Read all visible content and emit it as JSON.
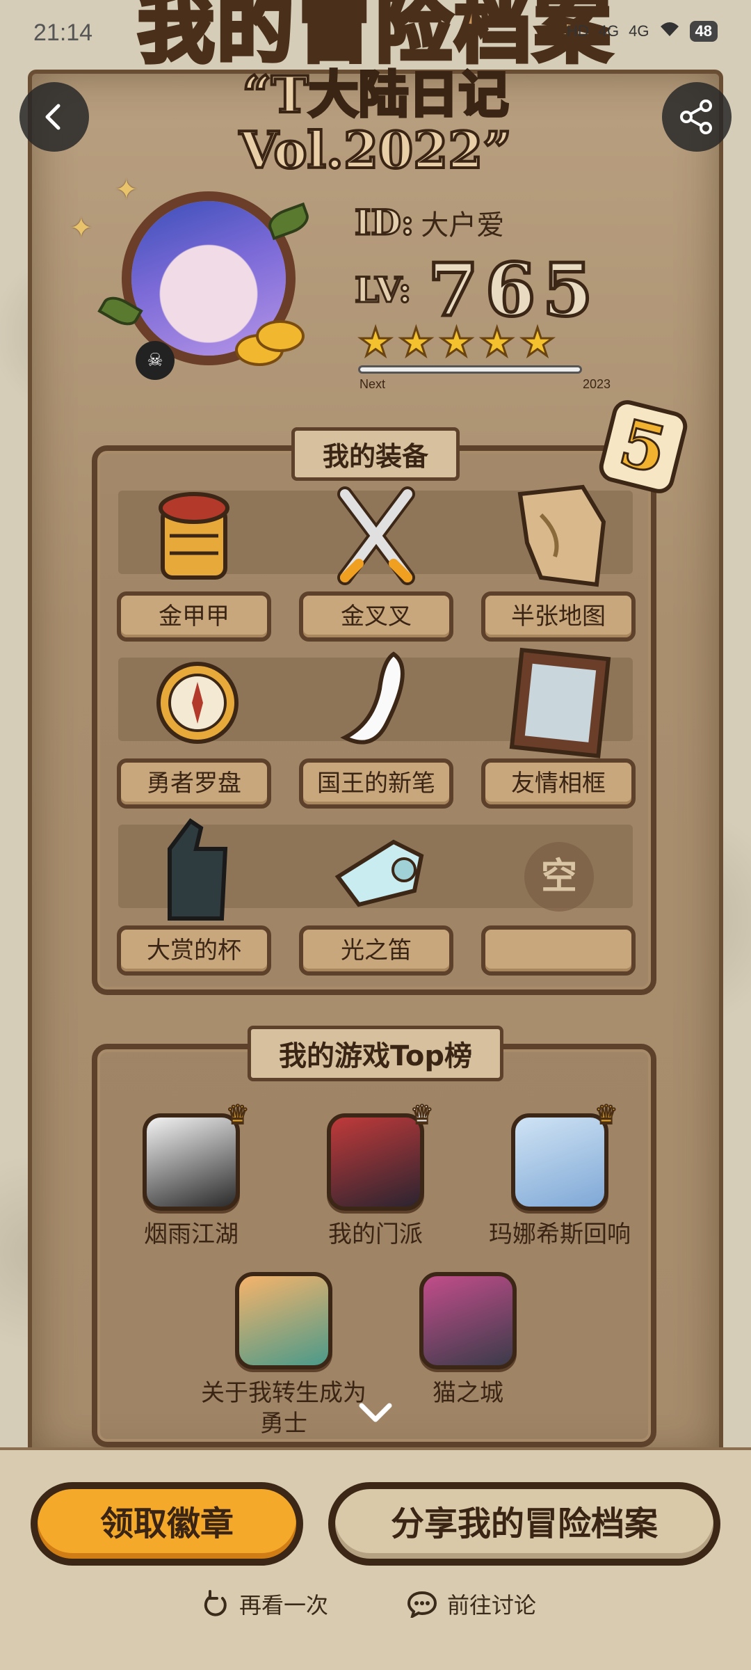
{
  "status_bar": {
    "time": "21:14",
    "network_1": "HD",
    "network_2": "4G",
    "network_3": "4G",
    "battery": "48"
  },
  "header": {
    "title": "我的冒险档案",
    "subtitle": "“T大陆日记 Vol.2022”"
  },
  "profile": {
    "id_label": "ID:",
    "name": "大户爱",
    "lv_label": "LV:",
    "level": "765",
    "stars": 5,
    "progress_next_label": "Next",
    "progress_year": "2023",
    "progress_fraction": 0.0
  },
  "equipment": {
    "title": "我的装备",
    "count_badge": "5",
    "items": [
      {
        "label": "金甲甲"
      },
      {
        "label": "金叉叉"
      },
      {
        "label": "半张地图"
      },
      {
        "label": "勇者罗盘"
      },
      {
        "label": "国王的新笔"
      },
      {
        "label": "友情相框"
      },
      {
        "label": "大赏的杯"
      },
      {
        "label": "光之笛"
      },
      {
        "label": "",
        "empty_text": "空"
      }
    ]
  },
  "games": {
    "title": "我的游戏Top榜",
    "items": [
      {
        "name": "烟雨江湖"
      },
      {
        "name": "我的门派"
      },
      {
        "name": "玛娜希斯回响"
      },
      {
        "name": "关于我转生成为勇士"
      },
      {
        "name": "猫之城"
      }
    ]
  },
  "actions": {
    "claim_badge": "领取徽章",
    "share_profile": "分享我的冒险档案",
    "replay": "再看一次",
    "discuss": "前往讨论"
  },
  "colors": {
    "accent": "#f4a92b",
    "border_dark": "#3c2716",
    "parchment": "#a98f6e"
  }
}
